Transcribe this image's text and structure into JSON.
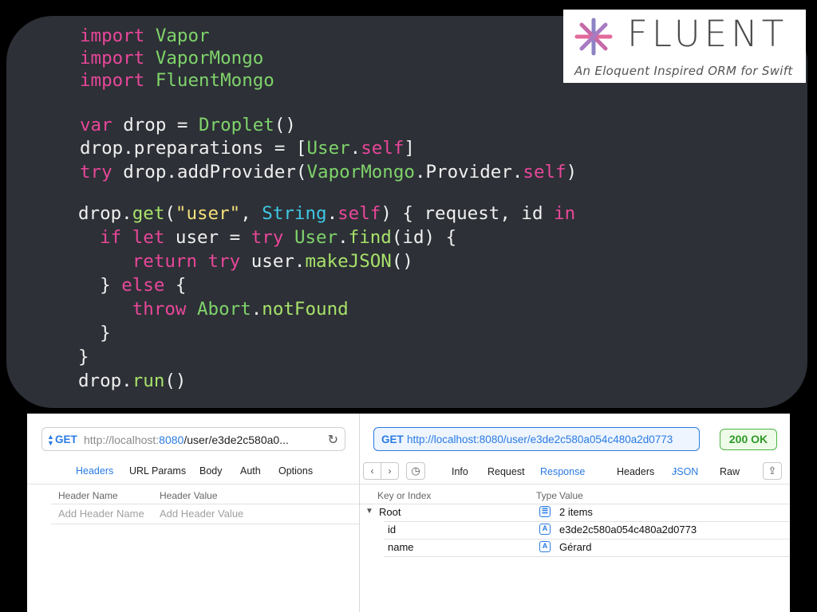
{
  "code": {
    "lines": [
      [
        [
          "import ",
          "kw"
        ],
        [
          "Vapor",
          "ty"
        ]
      ],
      [
        [
          "import ",
          "kw"
        ],
        [
          "VaporMongo",
          "ty"
        ]
      ],
      [
        [
          "import ",
          "kw"
        ],
        [
          "FluentMongo",
          "ty"
        ]
      ],
      [],
      [
        [
          "var ",
          "kw"
        ],
        [
          "drop = ",
          "pl"
        ],
        [
          "Droplet",
          "ty"
        ],
        [
          "()",
          "pl"
        ]
      ],
      [
        [
          "drop.preparations = [",
          "pl"
        ],
        [
          "User",
          "ty"
        ],
        [
          ".",
          "pl"
        ],
        [
          "self",
          "kw"
        ],
        [
          "]",
          "pl"
        ]
      ],
      [
        [
          "try ",
          "kw"
        ],
        [
          "drop.addProvider(",
          "pl"
        ],
        [
          "VaporMongo",
          "ty"
        ],
        [
          ".Provider.",
          "pl"
        ],
        [
          "self",
          "kw"
        ],
        [
          ")",
          "pl"
        ]
      ],
      [
        [
          "drop.",
          "pl"
        ],
        [
          "get",
          "fn"
        ],
        [
          "(",
          "pl"
        ],
        [
          "\"user\"",
          "st"
        ],
        [
          ", ",
          "pl"
        ],
        [
          "String",
          "cy"
        ],
        [
          ".",
          "pl"
        ],
        [
          "self",
          "kw"
        ],
        [
          ") { request, id ",
          "pl"
        ],
        [
          "in",
          "kw"
        ]
      ],
      [
        [
          "  if let ",
          "kw"
        ],
        [
          "user = ",
          "pl"
        ],
        [
          "try ",
          "kw"
        ],
        [
          "User",
          "ty"
        ],
        [
          ".",
          "pl"
        ],
        [
          "find",
          "fn"
        ],
        [
          "(id) {",
          "pl"
        ]
      ],
      [
        [
          "     return try ",
          "kw"
        ],
        [
          "user.",
          "pl"
        ],
        [
          "makeJSON",
          "fn"
        ],
        [
          "()",
          "pl"
        ]
      ],
      [
        [
          "  } ",
          "pl"
        ],
        [
          "else",
          "kw"
        ],
        [
          " {",
          "pl"
        ]
      ],
      [
        [
          "     throw ",
          "kw"
        ],
        [
          "Abort",
          "ty"
        ],
        [
          ".",
          "pl"
        ],
        [
          "notFound",
          "fn"
        ]
      ],
      [
        [
          "  }",
          "pl"
        ]
      ],
      [
        [
          "}",
          "pl"
        ]
      ],
      [
        [
          "drop.",
          "pl"
        ],
        [
          "run",
          "fn"
        ],
        [
          "()",
          "pl"
        ]
      ]
    ]
  },
  "logo": {
    "word": "FLUENT",
    "tagline": "An Eloquent Inspired ORM for Swift"
  },
  "request": {
    "method": "GET",
    "url_host": "http://localhost:",
    "url_port": "8080",
    "url_path": "/user/e3de2c580a0...",
    "tabs": [
      "Headers",
      "URL Params",
      "Body",
      "Auth",
      "Options"
    ],
    "columns": [
      "Header Name",
      "Header Value"
    ],
    "placeholders": [
      "Add Header Name",
      "Add Header Value"
    ]
  },
  "response": {
    "method": "GET",
    "url": "http://localhost:8080/user/e3de2c580a054c480a2d0773",
    "status": "200 OK",
    "nav_tabs": [
      "Info",
      "Request",
      "Response",
      "Headers",
      "JSON",
      "Raw"
    ],
    "columns": [
      "Key or Index",
      "Type",
      "Value"
    ],
    "rows": [
      {
        "key": "Root",
        "type_icon": "list-icon",
        "value": "2 items"
      },
      {
        "key": "id",
        "type_icon": "A",
        "value": "e3de2c580a054c480a2d0773"
      },
      {
        "key": "name",
        "type_icon": "A",
        "value": "Gérard"
      }
    ]
  }
}
